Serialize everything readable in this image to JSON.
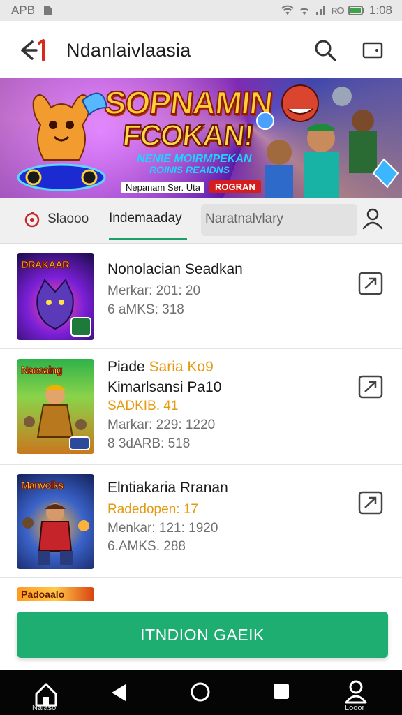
{
  "status_bar": {
    "carrier": "APB",
    "time": "1:08"
  },
  "app_bar": {
    "title": "Ndanlaivlaasia",
    "icons": [
      "back-arrow-icon",
      "search-icon",
      "wallet-icon"
    ]
  },
  "banner": {
    "headline_1": "SOPNAMIN",
    "headline_2": "FCOKAN!",
    "subline_1": "NENIE MOIRMPEKAN",
    "subline_2": "ROINIS REAIDNS",
    "promo_text": "Nepanam Ser. Uta",
    "cta_label": "ROGRAN"
  },
  "filter_bar": {
    "tab_1_label": "Slaooo",
    "tab_2_label": "Indemaaday",
    "search_placeholder": "Naratnalvlary"
  },
  "games": [
    {
      "thumb_label": "DRAKAAR",
      "title": "Nonolacian Seadkan",
      "meta_1": "Merkar: 201: 20",
      "meta_2": "6 aMKS: 318"
    },
    {
      "thumb_label": "Naesaing",
      "title_prefix": "Piade ",
      "title_highlight": "Saria Ko9",
      "title_line2": "Kimarlsansi Pa10",
      "orange_line": "SADKIB. 41",
      "meta_1": "Markar: 229: 1220",
      "meta_2": "8 3dARB: 518"
    },
    {
      "thumb_label": "Manvoiks",
      "title": "Elntiakaria Rranan",
      "orange_line": "Radedopen: 17",
      "meta_1": "Menkar: 121: 1920",
      "meta_2": "6.AMKS. 288"
    }
  ],
  "peek_thumb_label": "Padoaalo",
  "main_button_label": "ITNDION GAEIK",
  "nav_bar": {
    "home_label": "Naiaso",
    "profile_label": "Looor"
  },
  "colors": {
    "accent_green": "#1fae72",
    "tab_underline": "#1e9e69",
    "highlight_orange": "#e39b12",
    "back_arrow_accent": "#d62a1f"
  }
}
